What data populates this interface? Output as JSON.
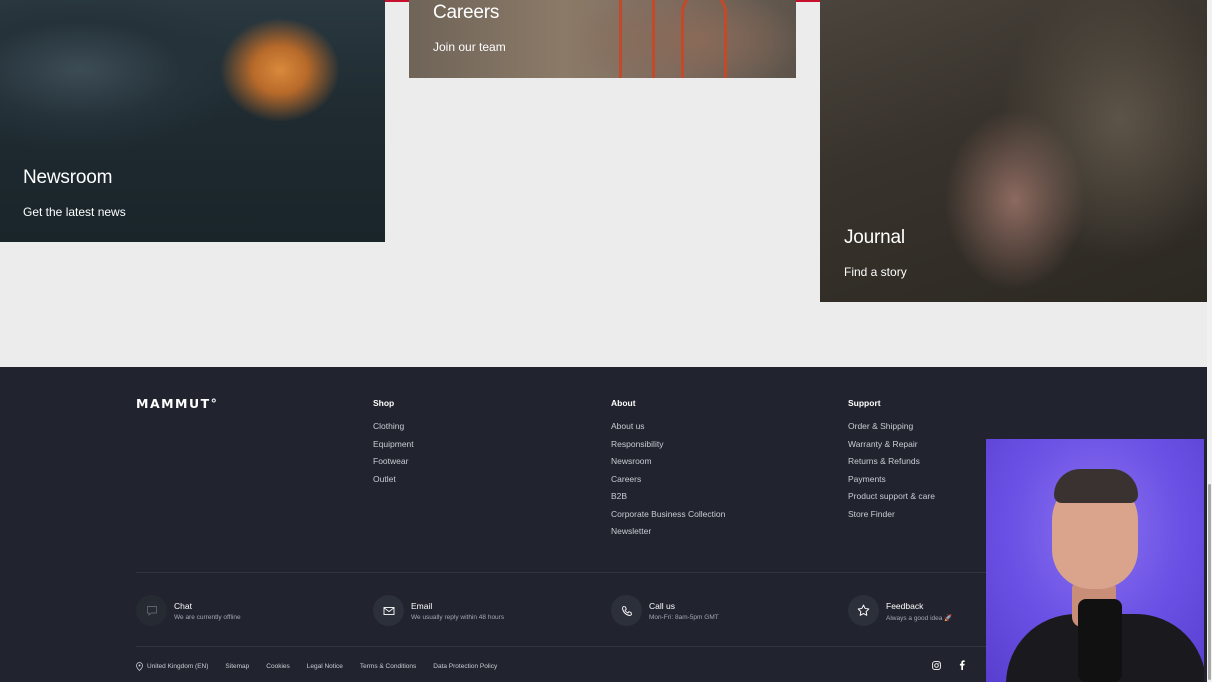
{
  "tiles": {
    "newsroom": {
      "title": "Newsroom",
      "subtitle": "Get the latest news"
    },
    "careers": {
      "title": "Careers",
      "subtitle": "Join our team"
    },
    "journal": {
      "title": "Journal",
      "subtitle": "Find a story"
    }
  },
  "footer": {
    "logo": "MAMMUT°",
    "columns": {
      "shop": {
        "heading": "Shop",
        "links": [
          "Clothing",
          "Equipment",
          "Footwear",
          "Outlet"
        ]
      },
      "about": {
        "heading": "About",
        "links": [
          "About us",
          "Responsibility",
          "Newsroom",
          "Careers",
          "B2B",
          "Corporate Business Collection",
          "Newsletter"
        ]
      },
      "support": {
        "heading": "Support",
        "links": [
          "Order & Shipping",
          "Warranty & Repair",
          "Returns & Refunds",
          "Payments",
          "Product support & care",
          "Store Finder"
        ]
      }
    },
    "contact": {
      "chat": {
        "title": "Chat",
        "subtitle": "We are currently offline",
        "icon": "chat-bubble-icon"
      },
      "email": {
        "title": "Email",
        "subtitle": "We usually reply within 48 hours",
        "icon": "envelope-icon"
      },
      "call": {
        "title": "Call us",
        "subtitle": "Mon-Fri: 8am-5pm GMT",
        "icon": "phone-icon"
      },
      "feedback": {
        "title": "Feedback",
        "subtitle": "Always a good idea 🚀",
        "icon": "star-icon"
      }
    },
    "bottom": {
      "region": "United Kingdom (EN)",
      "links": [
        "Sitemap",
        "Cookies",
        "Legal Notice",
        "Terms & Conditions",
        "Data Protection Policy"
      ]
    },
    "social": [
      "instagram-icon",
      "facebook-icon"
    ]
  },
  "colors": {
    "footer_bg": "#21242e",
    "page_bg": "#ececec",
    "accent_red": "#c8102e",
    "video_bg": "#6a50e4"
  }
}
